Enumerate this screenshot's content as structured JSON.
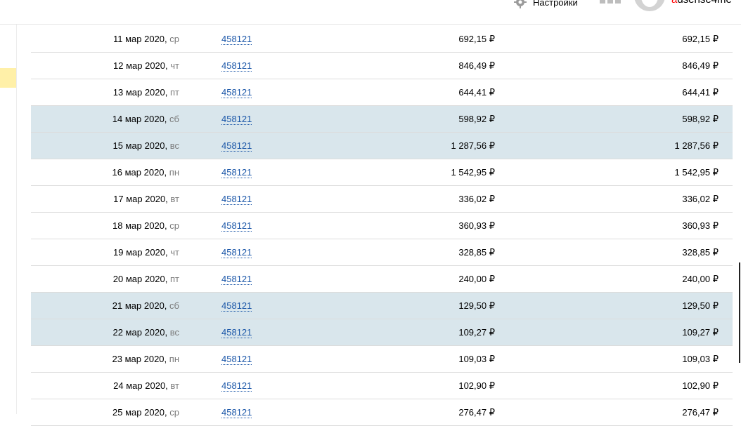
{
  "header": {
    "settings_label": "Настройки",
    "username_first": "a",
    "username_rest": "dsense4me"
  },
  "rows": [
    {
      "date": "11 мар 2020,",
      "dow": "ср",
      "id": "458121",
      "amount": "692,15 ₽",
      "total": "692,15 ₽",
      "weekend": false
    },
    {
      "date": "12 мар 2020,",
      "dow": "чт",
      "id": "458121",
      "amount": "846,49 ₽",
      "total": "846,49 ₽",
      "weekend": false
    },
    {
      "date": "13 мар 2020,",
      "dow": "пт",
      "id": "458121",
      "amount": "644,41 ₽",
      "total": "644,41 ₽",
      "weekend": false
    },
    {
      "date": "14 мар 2020,",
      "dow": "сб",
      "id": "458121",
      "amount": "598,92 ₽",
      "total": "598,92 ₽",
      "weekend": true
    },
    {
      "date": "15 мар 2020,",
      "dow": "вс",
      "id": "458121",
      "amount": "1 287,56 ₽",
      "total": "1 287,56 ₽",
      "weekend": true
    },
    {
      "date": "16 мар 2020,",
      "dow": "пн",
      "id": "458121",
      "amount": "1 542,95 ₽",
      "total": "1 542,95 ₽",
      "weekend": false
    },
    {
      "date": "17 мар 2020,",
      "dow": "вт",
      "id": "458121",
      "amount": "336,02 ₽",
      "total": "336,02 ₽",
      "weekend": false
    },
    {
      "date": "18 мар 2020,",
      "dow": "ср",
      "id": "458121",
      "amount": "360,93 ₽",
      "total": "360,93 ₽",
      "weekend": false
    },
    {
      "date": "19 мар 2020,",
      "dow": "чт",
      "id": "458121",
      "amount": "328,85 ₽",
      "total": "328,85 ₽",
      "weekend": false
    },
    {
      "date": "20 мар 2020,",
      "dow": "пт",
      "id": "458121",
      "amount": "240,00 ₽",
      "total": "240,00 ₽",
      "weekend": false
    },
    {
      "date": "21 мар 2020,",
      "dow": "сб",
      "id": "458121",
      "amount": "129,50 ₽",
      "total": "129,50 ₽",
      "weekend": true
    },
    {
      "date": "22 мар 2020,",
      "dow": "вс",
      "id": "458121",
      "amount": "109,27 ₽",
      "total": "109,27 ₽",
      "weekend": true
    },
    {
      "date": "23 мар 2020,",
      "dow": "пн",
      "id": "458121",
      "amount": "109,03 ₽",
      "total": "109,03 ₽",
      "weekend": false
    },
    {
      "date": "24 мар 2020,",
      "dow": "вт",
      "id": "458121",
      "amount": "102,90 ₽",
      "total": "102,90 ₽",
      "weekend": false
    },
    {
      "date": "25 мар 2020,",
      "dow": "ср",
      "id": "458121",
      "amount": "276,47 ₽",
      "total": "276,47 ₽",
      "weekend": false
    }
  ]
}
